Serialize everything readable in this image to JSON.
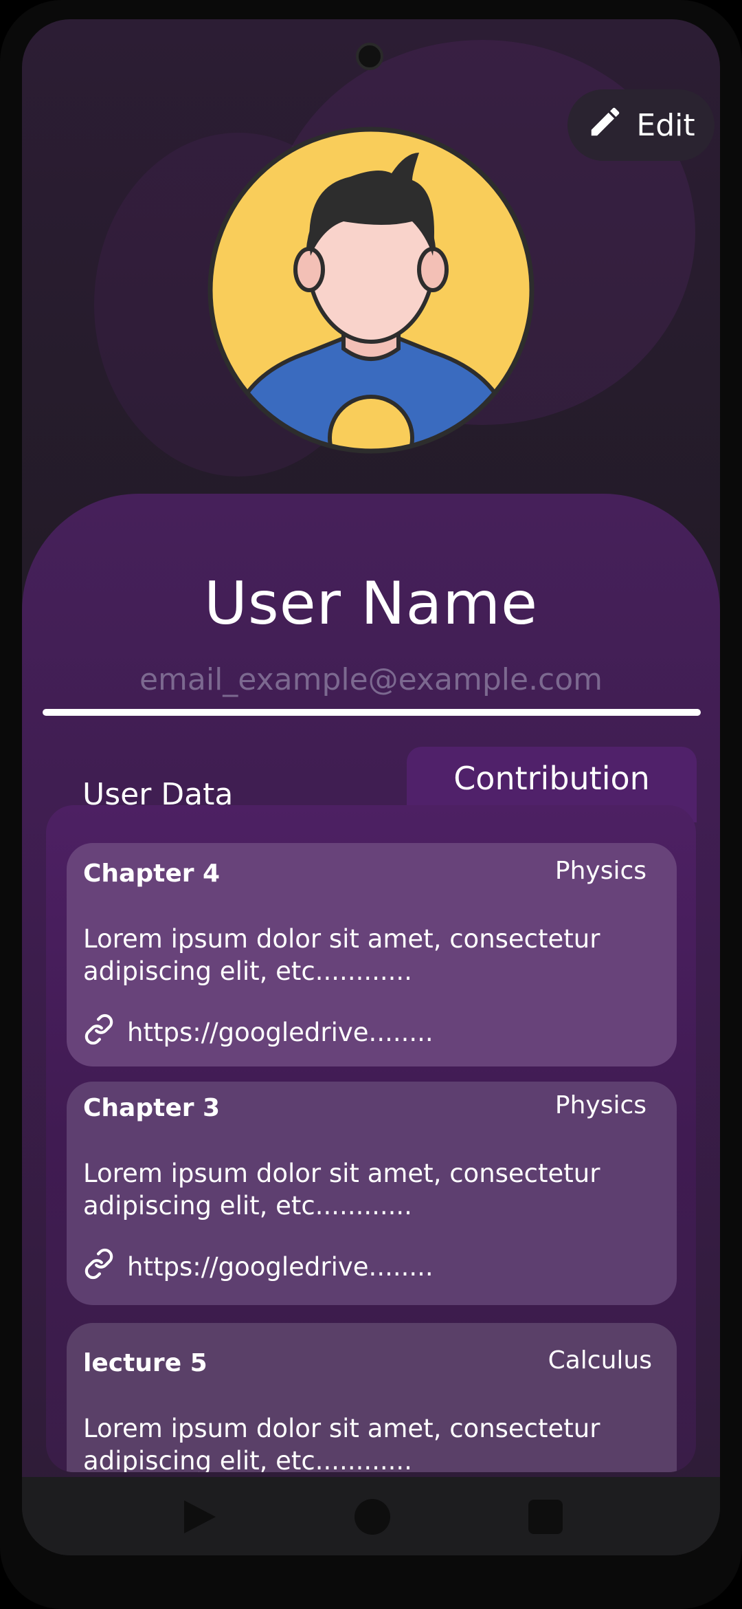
{
  "header": {
    "edit_label": "Edit",
    "edit_icon": "pencil-icon"
  },
  "profile": {
    "name": "User Name",
    "email": "email_example@example.com",
    "avatar_icon": "user-avatar"
  },
  "tabs": {
    "user_data": "User Data",
    "contribution": "Contribution",
    "selected": "Contribution"
  },
  "contributions": [
    {
      "title": "Chapter 4",
      "subject": "Physics",
      "description_line1": "Lorem ipsum dolor sit amet, consectetur",
      "description_line2": "adipiscing elit, etc............",
      "link": "https://googledrive........"
    },
    {
      "title": "Chapter 3",
      "subject": "Physics",
      "description_line1": "Lorem ipsum dolor sit amet, consectetur",
      "description_line2": "adipiscing elit, etc............",
      "link": "https://googledrive........"
    },
    {
      "title": "lecture 5",
      "subject": "Calculus",
      "description_line1": "Lorem ipsum dolor sit amet, consectetur",
      "description_line2": "adipiscing elit, etc............"
    }
  ],
  "navbar": {
    "back_icon": "back-triangle-icon",
    "home_icon": "home-circle-icon",
    "recents_icon": "recents-square-icon"
  },
  "colors": {
    "accent": "#50216a",
    "card1": "#68437a",
    "card2": "#5e3f70",
    "card3": "#5a4068",
    "avatar_bg": "#f9cd5a",
    "shirt": "#3a6bbf"
  }
}
